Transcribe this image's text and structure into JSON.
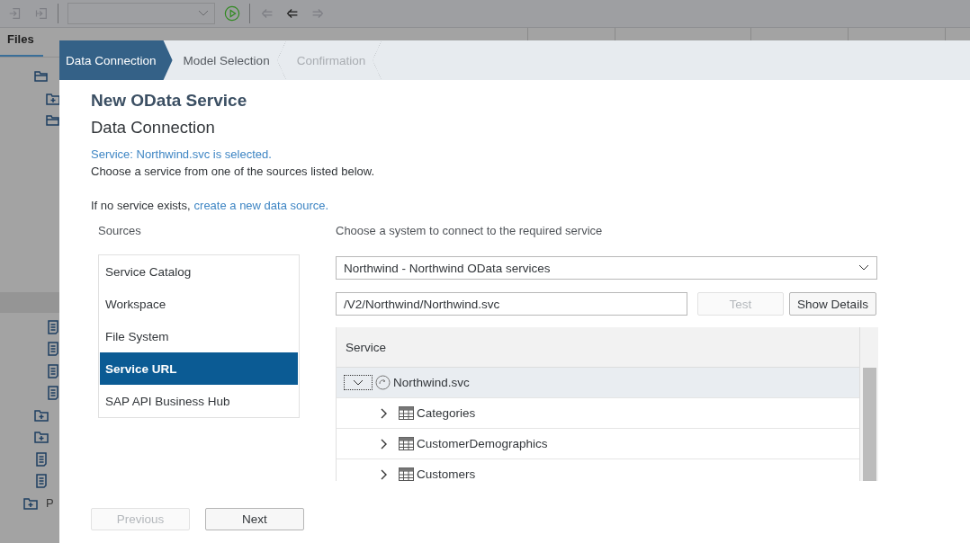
{
  "ide": {
    "toolbar": {
      "buttons": [
        {
          "kind": "import",
          "disabled": true
        },
        {
          "kind": "export",
          "disabled": true
        },
        {
          "kind": "dropdown"
        },
        {
          "kind": "run",
          "disabled": false
        },
        {
          "kind": "back-double",
          "disabled": true
        },
        {
          "kind": "back",
          "disabled": false
        },
        {
          "kind": "forward",
          "disabled": true
        }
      ]
    },
    "panel_tabs": [
      {
        "label": "Files",
        "selected": true
      }
    ],
    "tree_upper": [
      {
        "kind": "folder-open",
        "children": [
          {
            "kind": "folder-plus"
          },
          {
            "kind": "folder-open"
          }
        ]
      }
    ],
    "tree_lower": [
      {
        "kind": "document"
      },
      {
        "kind": "document"
      },
      {
        "kind": "document"
      },
      {
        "kind": "document"
      },
      {
        "kind": "folder-plus"
      },
      {
        "kind": "folder-plus"
      },
      {
        "kind": "document"
      },
      {
        "kind": "document"
      },
      {
        "kind": "folder-plus",
        "label": "P"
      }
    ]
  },
  "dialog": {
    "steps": [
      {
        "label": "Data Connection",
        "selected": true,
        "disabled": false
      },
      {
        "label": "Model Selection",
        "selected": false,
        "disabled": false
      },
      {
        "label": "Confirmation",
        "selected": false,
        "disabled": true
      }
    ],
    "title": "New OData Service",
    "subtitle": "Data Connection",
    "status": "Service: Northwind.svc is selected.",
    "instruction": "Choose a service from one of the sources listed below.",
    "hint": {
      "text": "If no service exists,",
      "link": "create a new data source."
    },
    "sources": {
      "label": "Sources",
      "items": [
        {
          "label": "Service Catalog",
          "selected": false
        },
        {
          "label": "Workspace",
          "selected": false
        },
        {
          "label": "File System",
          "selected": false
        },
        {
          "label": "Service URL",
          "selected": true
        },
        {
          "label": "SAP API Business Hub",
          "selected": false
        }
      ]
    },
    "system": {
      "label": "Choose a system to connect to the required service",
      "value": "Northwind - Northwind OData services"
    },
    "url": {
      "value": "/V2/Northwind/Northwind.svc"
    },
    "test_button": {
      "label": "Test",
      "disabled": true
    },
    "details_button": {
      "label": "Show Details",
      "disabled": false
    },
    "table": {
      "columns": [
        "Service"
      ],
      "rows": [
        {
          "label": "Northwind.svc",
          "kind": "service",
          "expanded": true,
          "children": [
            {
              "label": "Categories",
              "kind": "entity",
              "expanded": false
            },
            {
              "label": "CustomerDemographics",
              "kind": "entity",
              "expanded": false
            },
            {
              "label": "Customers",
              "kind": "entity",
              "expanded": false
            }
          ]
        }
      ]
    },
    "footer": [
      {
        "label": "Previous",
        "disabled": true
      },
      {
        "label": "Next",
        "disabled": false
      }
    ]
  }
}
